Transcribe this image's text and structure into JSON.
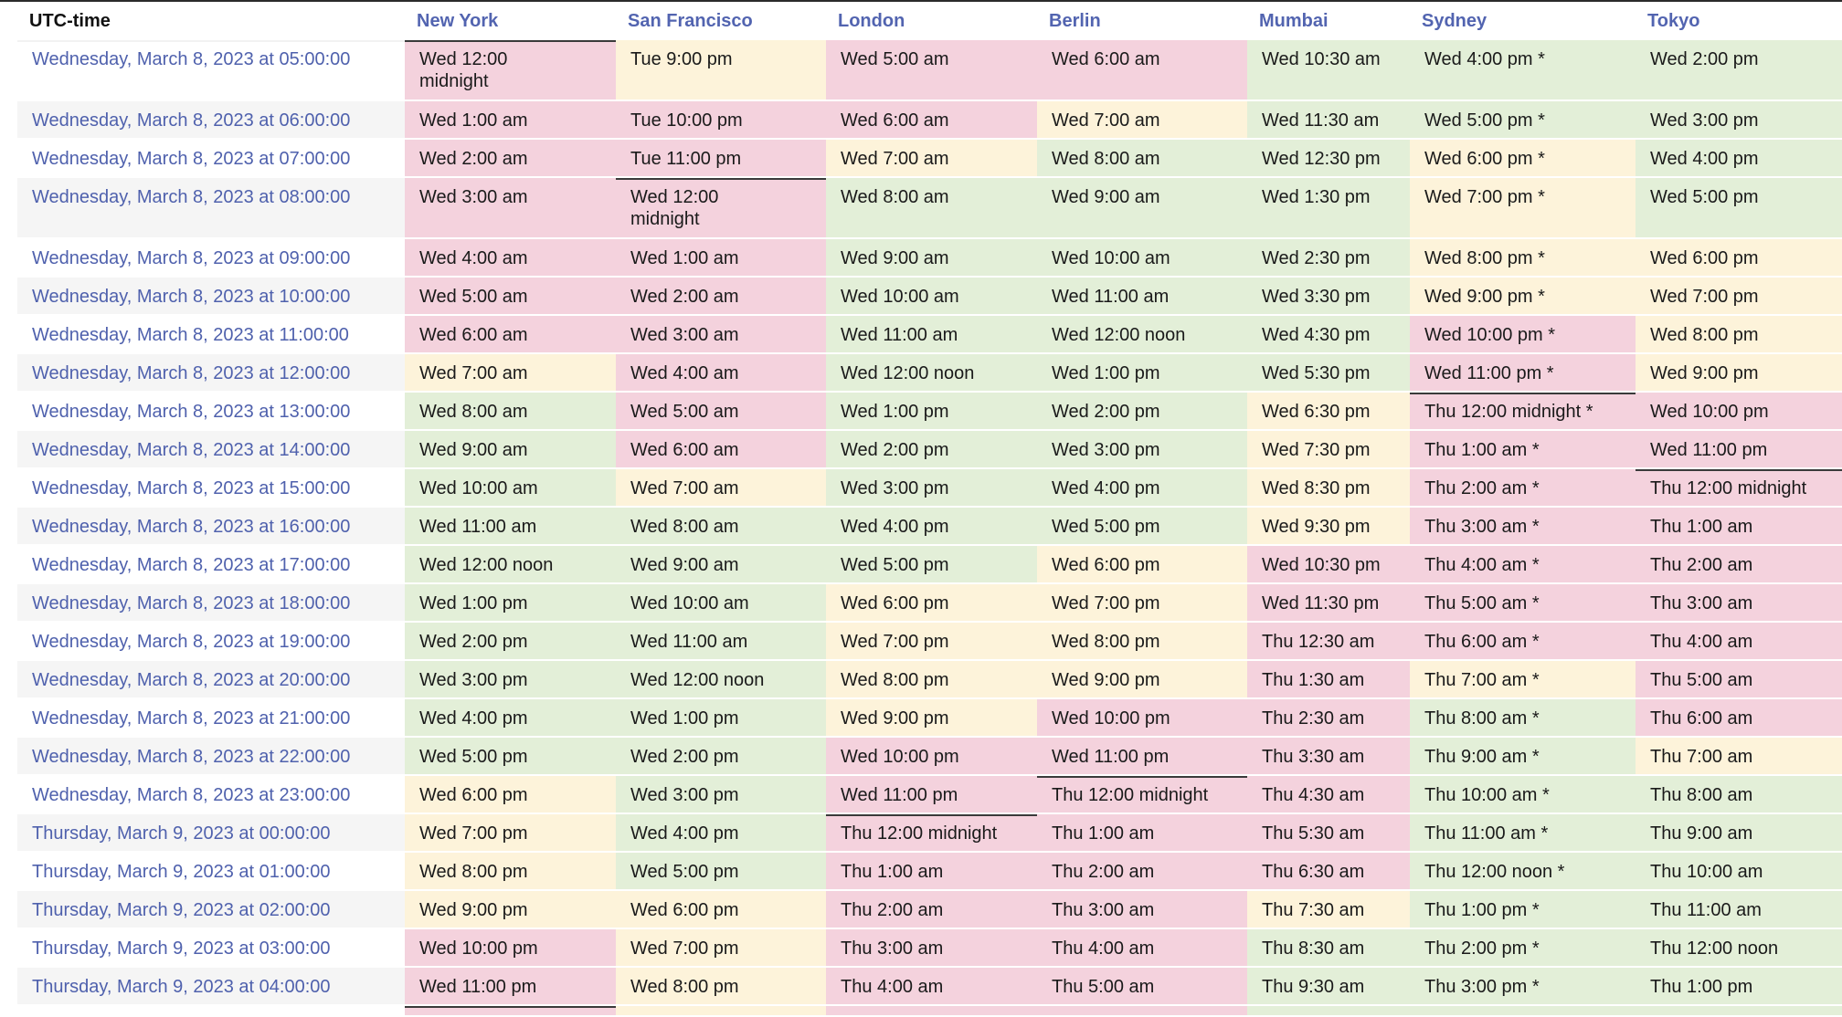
{
  "header": {
    "utc_label": "UTC-time",
    "cities": [
      "New York",
      "San Francisco",
      "London",
      "Berlin",
      "Mumbai",
      "Sydney",
      "Tokyo"
    ]
  },
  "colors": {
    "night": "#f4d2dd",
    "dusk": "#fdf3da",
    "day": "#e3efd8",
    "header_link": "#5264b0",
    "utc_link": "#4f61ad",
    "midnight_rule": "#3a3a3a"
  },
  "rows": [
    {
      "utc": "Wednesday, March 8, 2023 at 05:00:00",
      "cells": [
        "Wed 12:00 midnight",
        "Tue 9:00 pm",
        "Wed 5:00 am",
        "Wed 6:00 am",
        "Wed 10:30 am",
        "Wed 4:00 pm *",
        "Wed 2:00 pm"
      ],
      "shade": [
        "night",
        "dusk",
        "night",
        "night",
        "day",
        "day",
        "day"
      ]
    },
    {
      "utc": "Wednesday, March 8, 2023 at 06:00:00",
      "cells": [
        "Wed 1:00 am",
        "Tue 10:00 pm",
        "Wed 6:00 am",
        "Wed 7:00 am",
        "Wed 11:30 am",
        "Wed 5:00 pm *",
        "Wed 3:00 pm"
      ],
      "shade": [
        "night",
        "night",
        "night",
        "dusk",
        "day",
        "day",
        "day"
      ]
    },
    {
      "utc": "Wednesday, March 8, 2023 at 07:00:00",
      "cells": [
        "Wed 2:00 am",
        "Tue 11:00 pm",
        "Wed 7:00 am",
        "Wed 8:00 am",
        "Wed 12:30 pm",
        "Wed 6:00 pm *",
        "Wed 4:00 pm"
      ],
      "shade": [
        "night",
        "night",
        "dusk",
        "day",
        "day",
        "dusk",
        "day"
      ]
    },
    {
      "utc": "Wednesday, March 8, 2023 at 08:00:00",
      "cells": [
        "Wed 3:00 am",
        "Wed 12:00 midnight",
        "Wed 8:00 am",
        "Wed 9:00 am",
        "Wed 1:30 pm",
        "Wed 7:00 pm *",
        "Wed 5:00 pm"
      ],
      "shade": [
        "night",
        "night",
        "day",
        "day",
        "day",
        "dusk",
        "day"
      ]
    },
    {
      "utc": "Wednesday, March 8, 2023 at 09:00:00",
      "cells": [
        "Wed 4:00 am",
        "Wed 1:00 am",
        "Wed 9:00 am",
        "Wed 10:00 am",
        "Wed 2:30 pm",
        "Wed 8:00 pm *",
        "Wed 6:00 pm"
      ],
      "shade": [
        "night",
        "night",
        "day",
        "day",
        "day",
        "dusk",
        "dusk"
      ]
    },
    {
      "utc": "Wednesday, March 8, 2023 at 10:00:00",
      "cells": [
        "Wed 5:00 am",
        "Wed 2:00 am",
        "Wed 10:00 am",
        "Wed 11:00 am",
        "Wed 3:30 pm",
        "Wed 9:00 pm *",
        "Wed 7:00 pm"
      ],
      "shade": [
        "night",
        "night",
        "day",
        "day",
        "day",
        "dusk",
        "dusk"
      ]
    },
    {
      "utc": "Wednesday, March 8, 2023 at 11:00:00",
      "cells": [
        "Wed 6:00 am",
        "Wed 3:00 am",
        "Wed 11:00 am",
        "Wed 12:00 noon",
        "Wed 4:30 pm",
        "Wed 10:00 pm *",
        "Wed 8:00 pm"
      ],
      "shade": [
        "night",
        "night",
        "day",
        "day",
        "day",
        "night",
        "dusk"
      ]
    },
    {
      "utc": "Wednesday, March 8, 2023 at 12:00:00",
      "cells": [
        "Wed 7:00 am",
        "Wed 4:00 am",
        "Wed 12:00 noon",
        "Wed 1:00 pm",
        "Wed 5:30 pm",
        "Wed 11:00 pm *",
        "Wed 9:00 pm"
      ],
      "shade": [
        "dusk",
        "night",
        "day",
        "day",
        "day",
        "night",
        "dusk"
      ]
    },
    {
      "utc": "Wednesday, March 8, 2023 at 13:00:00",
      "cells": [
        "Wed 8:00 am",
        "Wed 5:00 am",
        "Wed 1:00 pm",
        "Wed 2:00 pm",
        "Wed 6:30 pm",
        "Thu 12:00 midnight *",
        "Wed 10:00 pm"
      ],
      "shade": [
        "day",
        "night",
        "day",
        "day",
        "dusk",
        "night",
        "night"
      ]
    },
    {
      "utc": "Wednesday, March 8, 2023 at 14:00:00",
      "cells": [
        "Wed 9:00 am",
        "Wed 6:00 am",
        "Wed 2:00 pm",
        "Wed 3:00 pm",
        "Wed 7:30 pm",
        "Thu 1:00 am *",
        "Wed 11:00 pm"
      ],
      "shade": [
        "day",
        "night",
        "day",
        "day",
        "dusk",
        "night",
        "night"
      ]
    },
    {
      "utc": "Wednesday, March 8, 2023 at 15:00:00",
      "cells": [
        "Wed 10:00 am",
        "Wed 7:00 am",
        "Wed 3:00 pm",
        "Wed 4:00 pm",
        "Wed 8:30 pm",
        "Thu 2:00 am *",
        "Thu 12:00 midnight"
      ],
      "shade": [
        "day",
        "dusk",
        "day",
        "day",
        "dusk",
        "night",
        "night"
      ]
    },
    {
      "utc": "Wednesday, March 8, 2023 at 16:00:00",
      "cells": [
        "Wed 11:00 am",
        "Wed 8:00 am",
        "Wed 4:00 pm",
        "Wed 5:00 pm",
        "Wed 9:30 pm",
        "Thu 3:00 am *",
        "Thu 1:00 am"
      ],
      "shade": [
        "day",
        "day",
        "day",
        "day",
        "dusk",
        "night",
        "night"
      ]
    },
    {
      "utc": "Wednesday, March 8, 2023 at 17:00:00",
      "cells": [
        "Wed 12:00 noon",
        "Wed 9:00 am",
        "Wed 5:00 pm",
        "Wed 6:00 pm",
        "Wed 10:30 pm",
        "Thu 4:00 am *",
        "Thu 2:00 am"
      ],
      "shade": [
        "day",
        "day",
        "day",
        "dusk",
        "night",
        "night",
        "night"
      ]
    },
    {
      "utc": "Wednesday, March 8, 2023 at 18:00:00",
      "cells": [
        "Wed 1:00 pm",
        "Wed 10:00 am",
        "Wed 6:00 pm",
        "Wed 7:00 pm",
        "Wed 11:30 pm",
        "Thu 5:00 am *",
        "Thu 3:00 am"
      ],
      "shade": [
        "day",
        "day",
        "dusk",
        "dusk",
        "night",
        "night",
        "night"
      ]
    },
    {
      "utc": "Wednesday, March 8, 2023 at 19:00:00",
      "cells": [
        "Wed 2:00 pm",
        "Wed 11:00 am",
        "Wed 7:00 pm",
        "Wed 8:00 pm",
        "Thu 12:30 am",
        "Thu 6:00 am *",
        "Thu 4:00 am"
      ],
      "shade": [
        "day",
        "day",
        "dusk",
        "dusk",
        "night",
        "night",
        "night"
      ]
    },
    {
      "utc": "Wednesday, March 8, 2023 at 20:00:00",
      "cells": [
        "Wed 3:00 pm",
        "Wed 12:00 noon",
        "Wed 8:00 pm",
        "Wed 9:00 pm",
        "Thu 1:30 am",
        "Thu 7:00 am *",
        "Thu 5:00 am"
      ],
      "shade": [
        "day",
        "day",
        "dusk",
        "dusk",
        "night",
        "dusk",
        "night"
      ]
    },
    {
      "utc": "Wednesday, March 8, 2023 at 21:00:00",
      "cells": [
        "Wed 4:00 pm",
        "Wed 1:00 pm",
        "Wed 9:00 pm",
        "Wed 10:00 pm",
        "Thu 2:30 am",
        "Thu 8:00 am *",
        "Thu 6:00 am"
      ],
      "shade": [
        "day",
        "day",
        "dusk",
        "night",
        "night",
        "day",
        "night"
      ]
    },
    {
      "utc": "Wednesday, March 8, 2023 at 22:00:00",
      "cells": [
        "Wed 5:00 pm",
        "Wed 2:00 pm",
        "Wed 10:00 pm",
        "Wed 11:00 pm",
        "Thu 3:30 am",
        "Thu 9:00 am *",
        "Thu 7:00 am"
      ],
      "shade": [
        "day",
        "day",
        "night",
        "night",
        "night",
        "day",
        "dusk"
      ]
    },
    {
      "utc": "Wednesday, March 8, 2023 at 23:00:00",
      "cells": [
        "Wed 6:00 pm",
        "Wed 3:00 pm",
        "Wed 11:00 pm",
        "Thu 12:00 midnight",
        "Thu 4:30 am",
        "Thu 10:00 am *",
        "Thu 8:00 am"
      ],
      "shade": [
        "dusk",
        "day",
        "night",
        "night",
        "night",
        "day",
        "day"
      ]
    },
    {
      "utc": "Thursday, March 9, 2023 at 00:00:00",
      "cells": [
        "Wed 7:00 pm",
        "Wed 4:00 pm",
        "Thu 12:00 midnight",
        "Thu 1:00 am",
        "Thu 5:30 am",
        "Thu 11:00 am *",
        "Thu 9:00 am"
      ],
      "shade": [
        "dusk",
        "day",
        "night",
        "night",
        "night",
        "day",
        "day"
      ]
    },
    {
      "utc": "Thursday, March 9, 2023 at 01:00:00",
      "cells": [
        "Wed 8:00 pm",
        "Wed 5:00 pm",
        "Thu 1:00 am",
        "Thu 2:00 am",
        "Thu 6:30 am",
        "Thu 12:00 noon *",
        "Thu 10:00 am"
      ],
      "shade": [
        "dusk",
        "day",
        "night",
        "night",
        "night",
        "day",
        "day"
      ]
    },
    {
      "utc": "Thursday, March 9, 2023 at 02:00:00",
      "cells": [
        "Wed 9:00 pm",
        "Wed 6:00 pm",
        "Thu 2:00 am",
        "Thu 3:00 am",
        "Thu 7:30 am",
        "Thu 1:00 pm *",
        "Thu 11:00 am"
      ],
      "shade": [
        "dusk",
        "dusk",
        "night",
        "night",
        "dusk",
        "day",
        "day"
      ]
    },
    {
      "utc": "Thursday, March 9, 2023 at 03:00:00",
      "cells": [
        "Wed 10:00 pm",
        "Wed 7:00 pm",
        "Thu 3:00 am",
        "Thu 4:00 am",
        "Thu 8:30 am",
        "Thu 2:00 pm *",
        "Thu 12:00 noon"
      ],
      "shade": [
        "night",
        "dusk",
        "night",
        "night",
        "day",
        "day",
        "day"
      ]
    },
    {
      "utc": "Thursday, March 9, 2023 at 04:00:00",
      "cells": [
        "Wed 11:00 pm",
        "Wed 8:00 pm",
        "Thu 4:00 am",
        "Thu 5:00 am",
        "Thu 9:30 am",
        "Thu 3:00 pm *",
        "Thu 1:00 pm"
      ],
      "shade": [
        "night",
        "dusk",
        "night",
        "night",
        "day",
        "day",
        "day"
      ]
    }
  ],
  "partial_row_shade": [
    "night",
    "dusk",
    "night",
    "night",
    "day",
    "day",
    "day"
  ]
}
